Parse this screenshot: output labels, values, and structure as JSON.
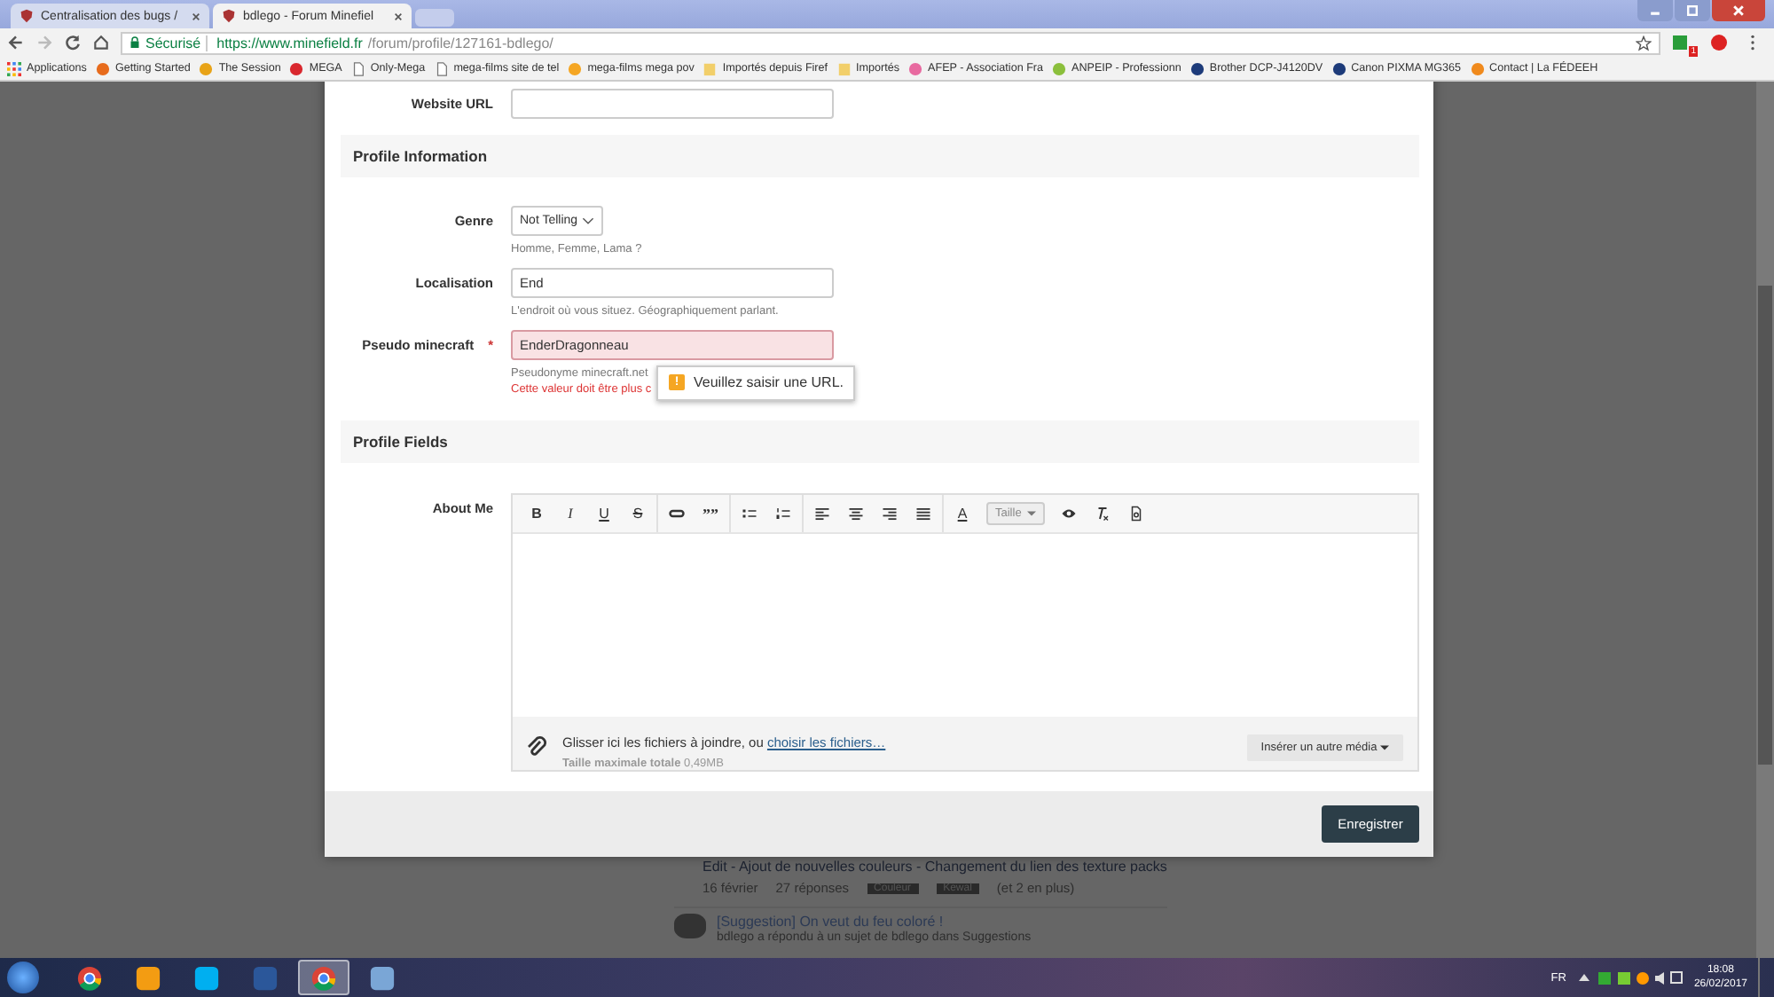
{
  "browser": {
    "tabs": [
      {
        "title": "Centralisation des bugs /",
        "selected": false
      },
      {
        "title": "bdlego - Forum Minefiel",
        "selected": true
      }
    ],
    "address": {
      "secure_label": "Sécurisé",
      "url_host": "https://www.minefield.fr",
      "url_path": "/forum/profile/127161-bdlego/"
    },
    "extension_badge": "1",
    "bookmarks": [
      {
        "kind": "apps",
        "label": "Applications"
      },
      {
        "kind": "firefox",
        "label": "Getting Started"
      },
      {
        "kind": "s",
        "label": "The Session"
      },
      {
        "kind": "mega",
        "label": "MEGA"
      },
      {
        "kind": "page",
        "label": "Only-Mega"
      },
      {
        "kind": "page",
        "label": "mega-films site de tel"
      },
      {
        "kind": "film",
        "label": "mega-films mega pov"
      },
      {
        "kind": "folder",
        "label": "Importés depuis Firef"
      },
      {
        "kind": "folder",
        "label": "Importés"
      },
      {
        "kind": "heart",
        "label": "AFEP - Association Fra"
      },
      {
        "kind": "leaf",
        "label": "ANPEIP - Professionn"
      },
      {
        "kind": "printer",
        "label": "Brother DCP-J4120DV"
      },
      {
        "kind": "printer",
        "label": "Canon PIXMA MG365"
      },
      {
        "kind": "fe",
        "label": "Contact | La FÉDEEH"
      }
    ]
  },
  "form": {
    "website_url": {
      "label": "Website URL"
    },
    "profile_information": {
      "title": "Profile Information",
      "genre": {
        "label": "Genre",
        "value": "Not Telling",
        "hint": "Homme, Femme, Lama ?"
      },
      "localisation": {
        "label": "Localisation",
        "value": "End",
        "hint": "L'endroit où vous situez. Géographiquement parlant."
      },
      "pseudo": {
        "label": "Pseudo minecraft",
        "required_mark": "*",
        "value": "EnderDragonneau",
        "hint": "Pseudonyme minecraft.net",
        "error": "Cette valeur doit être plus c",
        "invalid": true
      },
      "tooltip": {
        "icon": "!",
        "text": "Veuillez saisir une URL."
      }
    },
    "profile_fields": {
      "title": "Profile Fields",
      "about_me": {
        "label": "About Me",
        "toolbar": [
          {
            "kind": "bold",
            "glyph": "B"
          },
          {
            "kind": "italic",
            "glyph": "I"
          },
          {
            "kind": "underline",
            "glyph": "U"
          },
          {
            "kind": "strike",
            "glyph": "S"
          },
          {
            "kind": "sep"
          },
          {
            "kind": "link"
          },
          {
            "kind": "quote",
            "glyph": "””"
          },
          {
            "kind": "sep"
          },
          {
            "kind": "bullets"
          },
          {
            "kind": "numbers"
          },
          {
            "kind": "sep"
          },
          {
            "kind": "align-left"
          },
          {
            "kind": "align-center"
          },
          {
            "kind": "align-right"
          },
          {
            "kind": "justify"
          },
          {
            "kind": "sep"
          },
          {
            "kind": "color",
            "glyph": "A"
          },
          {
            "kind": "size",
            "glyph": "Taille"
          },
          {
            "kind": "preview"
          },
          {
            "kind": "clear"
          },
          {
            "kind": "source"
          }
        ],
        "attach_text": "Glisser ici les fichiers à joindre, ou ",
        "attach_link": "choisir les fichiers…",
        "max_label": "Taille maximale totale",
        "max_value": "0,49MB",
        "media_button": "Insérer un autre média"
      }
    },
    "save_button": "Enregistrer"
  },
  "background": {
    "topic_title": "Edit - Ajout de nouvelles couleurs - Changement du lien des texture packs",
    "date": "16 février",
    "replies": "27 réponses",
    "tags": [
      "Couleur",
      "Kewal"
    ],
    "more_tags": "(et 2 en plus)",
    "next_topic": "[Suggestion] On veut du feu coloré !",
    "next_activity": "bdlego a répondu à un sujet de bdlego dans Suggestions"
  },
  "taskbar": {
    "apps": [
      {
        "kind": "chrome",
        "selected": false
      },
      {
        "kind": "media",
        "selected": false
      },
      {
        "kind": "skype",
        "selected": false
      },
      {
        "kind": "word",
        "selected": false
      },
      {
        "kind": "chrome",
        "selected": true
      },
      {
        "kind": "paint",
        "selected": false
      }
    ],
    "language": "FR",
    "time": "18:08",
    "date": "26/02/2017"
  }
}
